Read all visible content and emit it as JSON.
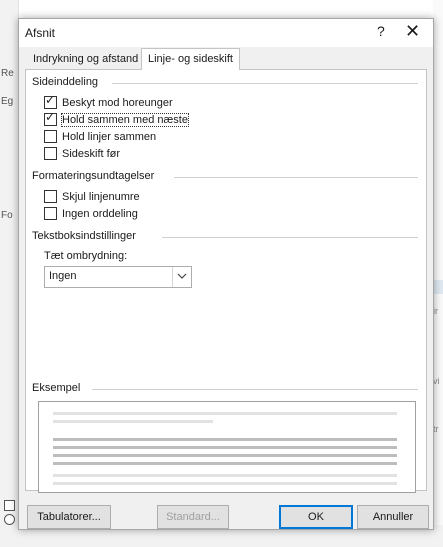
{
  "background": {
    "left_texts": [
      "Re",
      "Eg",
      "Fo"
    ],
    "right_texts": [
      "ir",
      "vi",
      "tr"
    ]
  },
  "dialog": {
    "title": "Afsnit",
    "help": "?",
    "close": "✕",
    "tabs": [
      {
        "label": "Indrykning og afstand",
        "active": false
      },
      {
        "label": "Linje- og sideskift",
        "active": true
      }
    ],
    "sections": {
      "pagination": {
        "title": "Sideinddeling",
        "options": [
          {
            "label": "Beskyt mod horeunger",
            "checked": true
          },
          {
            "label": "Hold sammen med næste",
            "checked": true,
            "focused": true
          },
          {
            "label": "Hold linjer sammen",
            "checked": false
          },
          {
            "label": "Sideskift før",
            "checked": false
          }
        ]
      },
      "formatting": {
        "title": "Formateringsundtagelser",
        "options": [
          {
            "label": "Skjul linjenumre",
            "checked": false
          },
          {
            "label": "Ingen orddeling",
            "checked": false
          }
        ]
      },
      "textbox": {
        "title": "Tekstboksindstillinger",
        "wrap_label": "Tæt ombrydning:",
        "wrap_value": "Ingen"
      },
      "preview": {
        "title": "Eksempel"
      }
    },
    "buttons": {
      "tabs": "Tabulatorer...",
      "default": "Standard...",
      "ok": "OK",
      "cancel": "Annuller"
    }
  }
}
